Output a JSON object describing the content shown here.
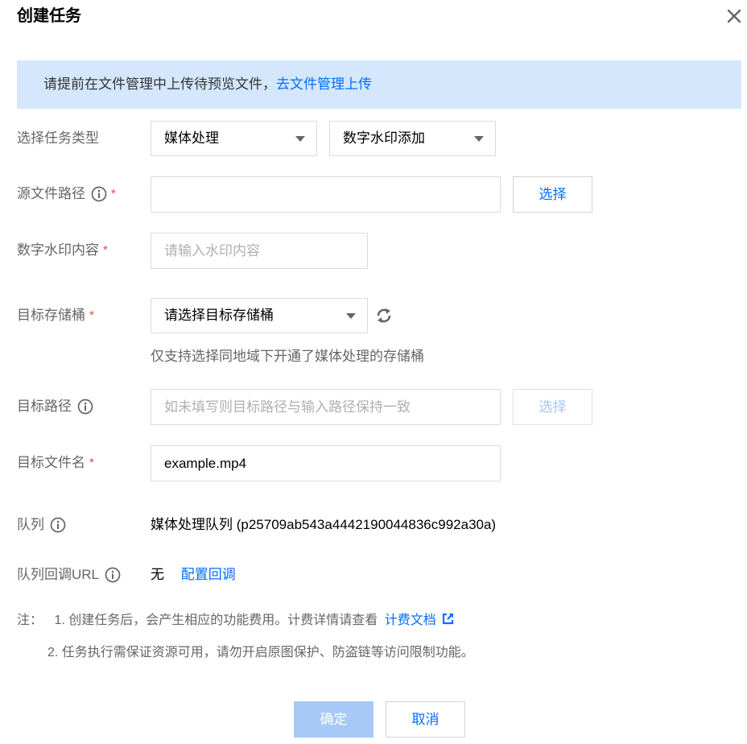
{
  "dialog": {
    "title": "创建任务",
    "close_icon": "close-icon"
  },
  "notice": {
    "text": "请提前在文件管理中上传待预览文件，",
    "link": "去文件管理上传"
  },
  "task_type": {
    "label": "选择任务类型",
    "category": "媒体处理",
    "subtype": "数字水印添加"
  },
  "source_path": {
    "label": "源文件路径",
    "required": "*",
    "value": "",
    "button": "选择"
  },
  "watermark": {
    "label": "数字水印内容",
    "required": "*",
    "placeholder": "请输入水印内容"
  },
  "target_bucket": {
    "label": "目标存储桶",
    "required": "*",
    "value": "请选择目标存储桶",
    "hint": "仅支持选择同地域下开通了媒体处理的存储桶"
  },
  "target_path": {
    "label": "目标路径",
    "placeholder": "如未填写则目标路径与输入路径保持一致",
    "button": "选择"
  },
  "target_filename": {
    "label": "目标文件名",
    "required": "*",
    "value": "example.mp4"
  },
  "queue": {
    "label": "队列",
    "value": "媒体处理队列 (p25709ab543a4442190044836c992a30a)"
  },
  "callback": {
    "label": "队列回调URL",
    "value": "无",
    "link": "配置回调"
  },
  "notes": {
    "prefix": "注：",
    "line1": "1. 创建任务后，会产生相应的功能费用。计费详情请查看",
    "line1_link": "计费文档",
    "line2": "2. 任务执行需保证资源可用，请勿开启原图保护、防盗链等访问限制功能。"
  },
  "footer": {
    "confirm": "确定",
    "cancel": "取消"
  },
  "colors": {
    "accent": "#006eff",
    "notice_bg": "#d5e7fd",
    "required": "#e54545",
    "disabled_primary": "#a6c9f7"
  }
}
